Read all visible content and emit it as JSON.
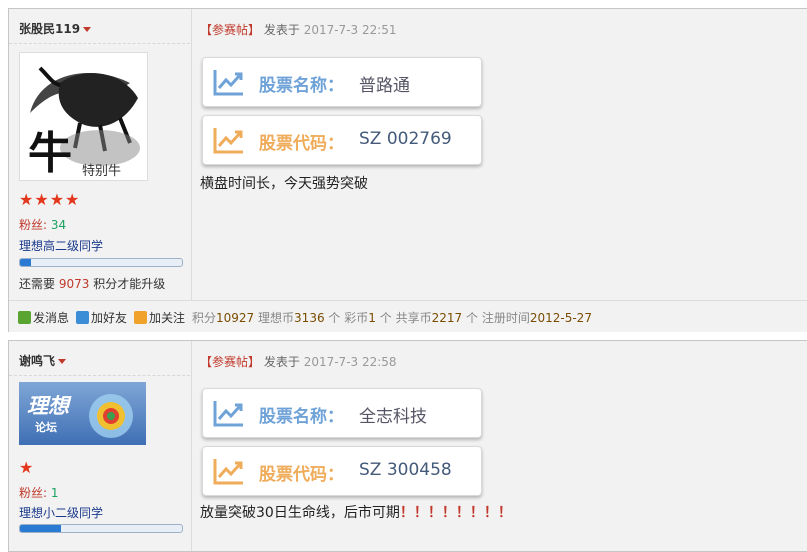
{
  "posts": [
    {
      "username": "张股民119",
      "fans_label": "粉丝:",
      "fans_count": "34",
      "grade": "理想高二级同学",
      "level_progress": 0.07,
      "upgrade_pre": "还需要",
      "upgrade_points": "9073",
      "upgrade_post": "积分才能升级",
      "avatar_text": "牛",
      "avatar_sig": "特别牛",
      "meta_tag": "【参赛帖】",
      "meta_label": "发表于",
      "meta_date": "2017-7-3 22:51",
      "stock_name_label": "股票名称：",
      "stock_name": "普路通",
      "stock_code_label": "股票代码：",
      "stock_code": "SZ 002769",
      "body_text": "横盘时间长，今天强势突破",
      "actions": {
        "message": "发消息",
        "add_friend": "加好友",
        "follow": "加关注"
      },
      "stats": {
        "points_label": "积分",
        "points": "10927",
        "lixiang_label": "理想币",
        "lixiang": "3136",
        "lixiang_unit": "个",
        "caibi_label": "彩币",
        "caibi": "1",
        "caibi_unit": "个",
        "share_label": "共享币",
        "share": "2217",
        "share_unit": "个",
        "reg_label": "注册时间",
        "reg": "2012-5-27"
      }
    },
    {
      "username": "谢鸣飞",
      "fans_label": "粉丝:",
      "fans_count": "1",
      "grade": "理想小二级同学",
      "level_progress": 0.25,
      "avatar_text": "理想",
      "avatar_sub": "论坛",
      "meta_tag": "【参赛帖】",
      "meta_label": "发表于",
      "meta_date": "2017-7-3 22:58",
      "stock_name_label": "股票名称：",
      "stock_name": "全志科技",
      "stock_code_label": "股票代码：",
      "stock_code": "SZ 300458",
      "body_text": "放量突破30日生命线，后市可期",
      "body_excl": "！！！！！！！！"
    }
  ],
  "colors": {
    "accent_red": "#c0392b",
    "chart_blue": "#6fa3d8",
    "chart_orange": "#efac5a",
    "stars": "#e2371d"
  }
}
